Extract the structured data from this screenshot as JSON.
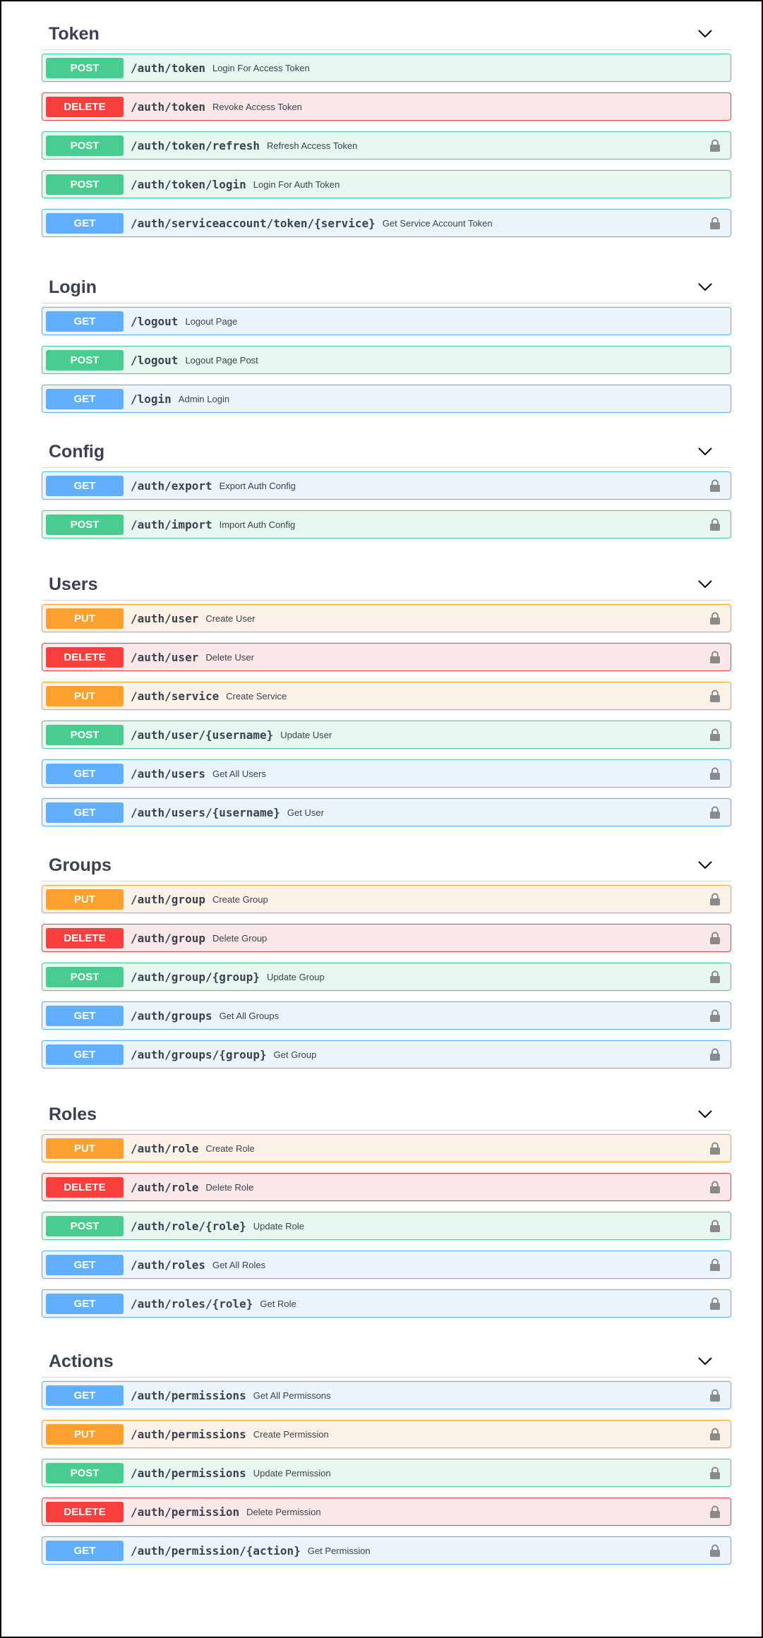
{
  "colors": {
    "get": "#61affe",
    "post": "#49cc90",
    "put": "#fca130",
    "delete": "#f93e3e",
    "text": "#3b4151"
  },
  "icons": {
    "expand": "chevron-down-icon",
    "auth": "lock-icon"
  },
  "sections": [
    {
      "title": "Token",
      "ops": [
        {
          "method": "POST",
          "path": "/auth/token",
          "summary": "Login For Access Token",
          "lock": false
        },
        {
          "method": "DELETE",
          "path": "/auth/token",
          "summary": "Revoke Access Token",
          "lock": false
        },
        {
          "method": "POST",
          "path": "/auth/token/refresh",
          "summary": "Refresh Access Token",
          "lock": true
        },
        {
          "method": "POST",
          "path": "/auth/token/login",
          "summary": "Login For Auth Token",
          "lock": false
        },
        {
          "method": "GET",
          "path": "/auth/serviceaccount/token/{service}",
          "summary": "Get Service Account Token",
          "lock": true
        }
      ]
    },
    {
      "title": "Login",
      "ops": [
        {
          "method": "GET",
          "path": "/logout",
          "summary": "Logout Page",
          "lock": false
        },
        {
          "method": "POST",
          "path": "/logout",
          "summary": "Logout Page Post",
          "lock": false
        },
        {
          "method": "GET",
          "path": "/login",
          "summary": "Admin Login",
          "lock": false
        }
      ]
    },
    {
      "title": "Config",
      "ops": [
        {
          "method": "GET",
          "path": "/auth/export",
          "summary": "Export Auth Config",
          "lock": true
        },
        {
          "method": "POST",
          "path": "/auth/import",
          "summary": "Import Auth Config",
          "lock": true
        }
      ]
    },
    {
      "title": "Users",
      "ops": [
        {
          "method": "PUT",
          "path": "/auth/user",
          "summary": "Create User",
          "lock": true
        },
        {
          "method": "DELETE",
          "path": "/auth/user",
          "summary": "Delete User",
          "lock": true
        },
        {
          "method": "PUT",
          "path": "/auth/service",
          "summary": "Create Service",
          "lock": true
        },
        {
          "method": "POST",
          "path": "/auth/user/{username}",
          "summary": "Update User",
          "lock": true
        },
        {
          "method": "GET",
          "path": "/auth/users",
          "summary": "Get All Users",
          "lock": true
        },
        {
          "method": "GET",
          "path": "/auth/users/{username}",
          "summary": "Get User",
          "lock": true
        }
      ]
    },
    {
      "title": "Groups",
      "ops": [
        {
          "method": "PUT",
          "path": "/auth/group",
          "summary": "Create Group",
          "lock": true
        },
        {
          "method": "DELETE",
          "path": "/auth/group",
          "summary": "Delete Group",
          "lock": true
        },
        {
          "method": "POST",
          "path": "/auth/group/{group}",
          "summary": "Update Group",
          "lock": true
        },
        {
          "method": "GET",
          "path": "/auth/groups",
          "summary": "Get All Groups",
          "lock": true
        },
        {
          "method": "GET",
          "path": "/auth/groups/{group}",
          "summary": "Get Group",
          "lock": true
        }
      ]
    },
    {
      "title": "Roles",
      "ops": [
        {
          "method": "PUT",
          "path": "/auth/role",
          "summary": "Create Role",
          "lock": true
        },
        {
          "method": "DELETE",
          "path": "/auth/role",
          "summary": "Delete Role",
          "lock": true
        },
        {
          "method": "POST",
          "path": "/auth/role/{role}",
          "summary": "Update Role",
          "lock": true
        },
        {
          "method": "GET",
          "path": "/auth/roles",
          "summary": "Get All Roles",
          "lock": true
        },
        {
          "method": "GET",
          "path": "/auth/roles/{role}",
          "summary": "Get Role",
          "lock": true
        }
      ]
    },
    {
      "title": "Actions",
      "ops": [
        {
          "method": "GET",
          "path": "/auth/permissions",
          "summary": "Get All Permissons",
          "lock": true
        },
        {
          "method": "PUT",
          "path": "/auth/permissions",
          "summary": "Create Permission",
          "lock": true
        },
        {
          "method": "POST",
          "path": "/auth/permissions",
          "summary": "Update Permission",
          "lock": true
        },
        {
          "method": "DELETE",
          "path": "/auth/permission",
          "summary": "Delete Permission",
          "lock": true
        },
        {
          "method": "GET",
          "path": "/auth/permission/{action}",
          "summary": "Get Permission",
          "lock": true
        }
      ]
    }
  ]
}
